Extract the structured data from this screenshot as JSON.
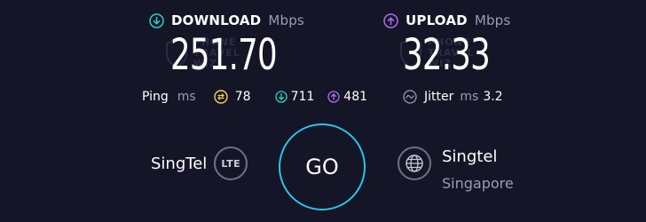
{
  "download": {
    "label": "DOWNLOAD",
    "unit": "Mbps",
    "value": "251.70",
    "accent": "#26d4c4",
    "icon": "download-arrow-icon"
  },
  "upload": {
    "label": "UPLOAD",
    "unit": "Mbps",
    "value": "32.33",
    "accent": "#b06cf0",
    "icon": "upload-arrow-icon"
  },
  "watermark": {
    "lines": [
      "PHONE",
      "TRAVEL",
      "WIZ"
    ]
  },
  "ping": {
    "label": "Ping",
    "unit": "ms",
    "idle": "78",
    "download": "711",
    "upload": "481",
    "idle_color": "#f5d34a"
  },
  "jitter": {
    "label": "Jitter",
    "unit": "ms",
    "value": "3.2"
  },
  "isp": {
    "name": "SingTel",
    "badge": "LTE"
  },
  "go_label": "GO",
  "server": {
    "name": "Singtel",
    "location": "Singapore"
  }
}
